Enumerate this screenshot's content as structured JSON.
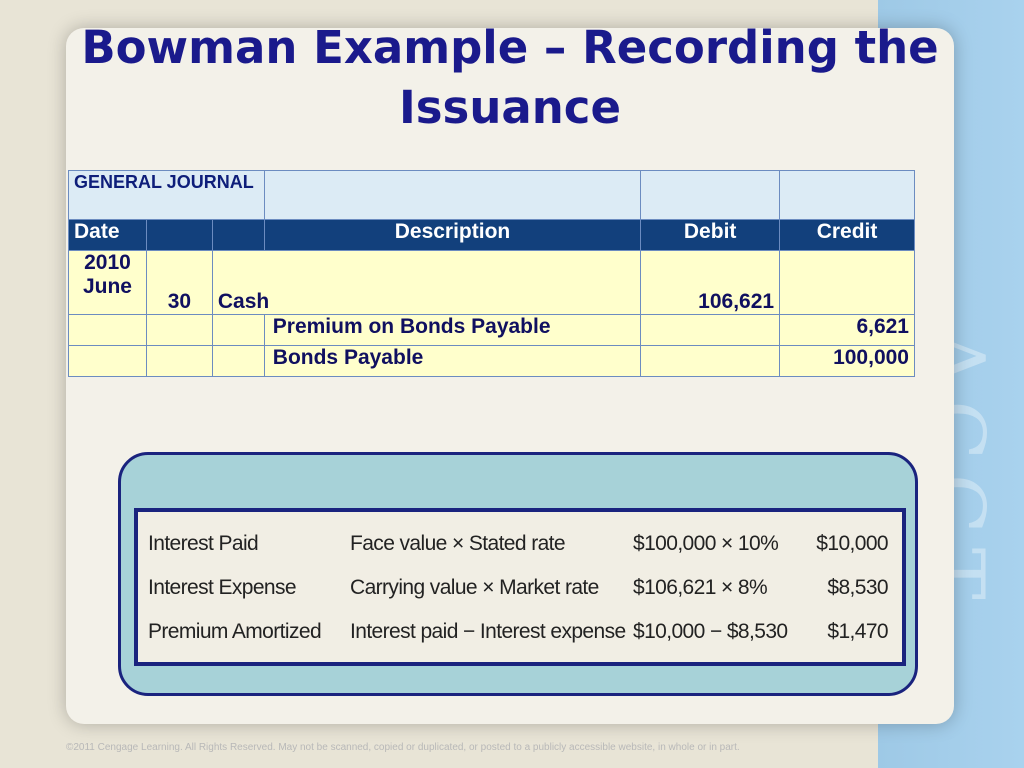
{
  "slide": {
    "title": "Bowman Example – Recording the Issuance",
    "watermark": "ACCT"
  },
  "journal": {
    "heading": "GENERAL JOURNAL",
    "columns": {
      "date": "Date",
      "description": "Description",
      "debit": "Debit",
      "credit": "Credit"
    },
    "rows": [
      {
        "year": "2010",
        "month": "June",
        "day": "30",
        "description": "Cash",
        "debit": "106,621",
        "credit": ""
      },
      {
        "year": "",
        "month": "",
        "day": "",
        "description": "Premium on Bonds Payable",
        "debit": "",
        "credit": "6,621"
      },
      {
        "year": "",
        "month": "",
        "day": "",
        "description": "Bonds Payable",
        "debit": "",
        "credit": "100,000"
      }
    ]
  },
  "calculation": {
    "rows": [
      {
        "label": "Interest Paid",
        "formula": "Face value × Stated rate",
        "values": "$100,000 × 10%",
        "result": "$10,000"
      },
      {
        "label": "Interest Expense",
        "formula": "Carrying value × Market rate",
        "values": "$106,621 × 8%",
        "result": "$8,530"
      },
      {
        "label": "Premium Amortized",
        "formula": "Interest paid − Interest expense",
        "values": "$10,000 − $8,530",
        "result": "$1,470"
      }
    ]
  },
  "footer": {
    "copyright": "©2011 Cengage Learning. All Rights Reserved. May not be scanned, copied or duplicated, or posted to a publicly accessible website, in whole or in part."
  }
}
